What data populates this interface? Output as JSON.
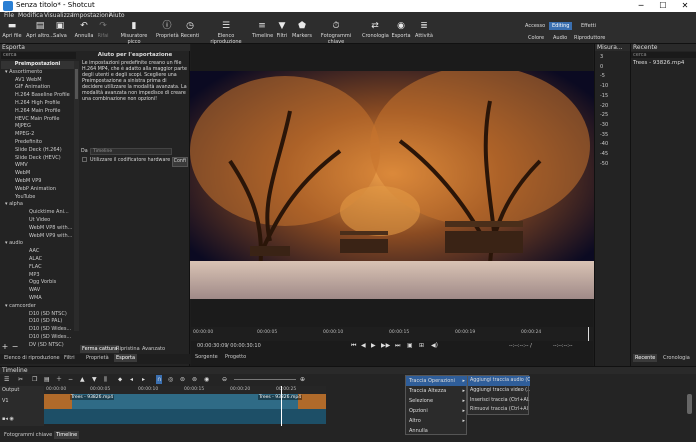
{
  "window": {
    "title": "Senza titolo* - Shotcut",
    "minimize": "─",
    "maximize": "☐",
    "close": "✕"
  },
  "menu": [
    "File",
    "Modifica",
    "Visualizza",
    "Impostazioni",
    "Aiuto"
  ],
  "toolbar": {
    "items": [
      "Apri file",
      "Apri altro...",
      "Salva",
      "Annulla",
      "Rifai",
      "Misuratore picco",
      "Proprietà",
      "Recenti",
      "Elenco riproduzione",
      "Timeline",
      "Filtri",
      "Markers",
      "Fotogrammi chiave",
      "Cronologia",
      "Esporta",
      "Attività"
    ]
  },
  "layouts": {
    "access": "Accesso",
    "editing": "Editing",
    "effects": "Effetti",
    "color": "Colore",
    "audio": "Audio",
    "player": "Riproduttore"
  },
  "export": {
    "header": "Esporta",
    "filter_placeholder": "cerca",
    "presets": [
      {
        "label": "Preimpostazioni",
        "level": "sel"
      },
      {
        "label": "▾ Assortimento",
        "level": "g"
      },
      {
        "label": "AV1 WebM",
        "level": "c1"
      },
      {
        "label": "GIF Animation",
        "level": "c1"
      },
      {
        "label": "H.264 Baseline Profile",
        "level": "c1"
      },
      {
        "label": "H.264 High Profile",
        "level": "c1"
      },
      {
        "label": "H.264 Main Profile",
        "level": "c1"
      },
      {
        "label": "HEVC Main Profile",
        "level": "c1"
      },
      {
        "label": "MJPEG",
        "level": "c1"
      },
      {
        "label": "MPEG-2",
        "level": "c1"
      },
      {
        "label": "Predefinito",
        "level": "c1"
      },
      {
        "label": "Slide Deck (H.264)",
        "level": "c1"
      },
      {
        "label": "Slide Deck (HEVC)",
        "level": "c1"
      },
      {
        "label": "WMV",
        "level": "c1"
      },
      {
        "label": "WebM",
        "level": "c1"
      },
      {
        "label": "WebM VP9",
        "level": "c1"
      },
      {
        "label": "WebP Animation",
        "level": "c1"
      },
      {
        "label": "YouTube",
        "level": "c1"
      },
      {
        "label": "▾ alpha",
        "level": "g"
      },
      {
        "label": "Quicktime Ani...",
        "level": "c2"
      },
      {
        "label": "Ut Video",
        "level": "c2"
      },
      {
        "label": "WebM VP8 with...",
        "level": "c2"
      },
      {
        "label": "WebM VP9 with...",
        "level": "c2"
      },
      {
        "label": "▾ audio",
        "level": "g"
      },
      {
        "label": "AAC",
        "level": "c2"
      },
      {
        "label": "ALAC",
        "level": "c2"
      },
      {
        "label": "FLAC",
        "level": "c2"
      },
      {
        "label": "MP3",
        "level": "c2"
      },
      {
        "label": "Ogg Vorbis",
        "level": "c2"
      },
      {
        "label": "WAV",
        "level": "c2"
      },
      {
        "label": "WMA",
        "level": "c2"
      },
      {
        "label": "▾ camcorder",
        "level": "g"
      },
      {
        "label": "D10 (SD NTSC)",
        "level": "c2"
      },
      {
        "label": "D10 (SD PAL)",
        "level": "c2"
      },
      {
        "label": "D10 (SD Wides...",
        "level": "c2"
      },
      {
        "label": "D10 (SD Wides...",
        "level": "c2"
      },
      {
        "label": "DV (SD NTSC)",
        "level": "c2"
      }
    ],
    "help_title": "Aiuto per l'esportazione",
    "help_text": "Le impostazioni predefinite creano un file H.264 MP4, che è adatto alla maggior parte degli utenti e degli scopi. Scegliere una Preimpostazione a sinistra prima di decidere utilizzare la modalità avanzata. La modalità avanzata non impedisce di creare una combinazione non opzioni!",
    "codec_label": "Da",
    "codec_value": "Timeline",
    "hw_label": "Utilizzare il codificatore hardware",
    "config_button": "Confi",
    "add": "+",
    "remove": "−",
    "tabs": {
      "stop": "Ferma cattura",
      "reset": "Ripristina",
      "advanced": "Avanzato"
    }
  },
  "left_tabs": [
    "Elenco di riproduzione",
    "Filtri",
    "Proprietà",
    "Esporta"
  ],
  "viewer": {
    "ruler": [
      "00:00:00",
      "00:00:05",
      "00:00:10",
      "00:00:15",
      "00:00:19",
      "00:00:24"
    ],
    "timecode": "00:00:30:09",
    "duration": "/ 00:00:30:10",
    "in_out": "--:--:--:-- /",
    "in_out2": "--:--:--:--",
    "tabs": [
      "Sorgente",
      "Progetto"
    ],
    "video_alt": "Snowy night trees"
  },
  "audiometer": {
    "header": "Misura...",
    "labels": [
      "3",
      "0",
      "-5",
      "-10",
      "-15",
      "-20",
      "-25",
      "-30",
      "-35",
      "-40",
      "-45",
      "-50"
    ]
  },
  "recent": {
    "header": "Recente",
    "search_placeholder": "cerca",
    "item": "Trees - 93826.mp4",
    "tabs": [
      "Recente",
      "Cronologia"
    ]
  },
  "timeline": {
    "header": "Timeline",
    "output_label": "Output",
    "track_label": "V1",
    "ruler": [
      "00:00:00",
      "00:00:05",
      "00:00:10",
      "00:00:15",
      "00:00:20",
      "00:00:25"
    ],
    "clip1": "Trees - 93826.mp4",
    "clip2": "Trees - 93826.mp4",
    "menu": [
      "Traccia Operazioni",
      "Traccia Altezza",
      "Selezione",
      "Opzioni",
      "Altro",
      "Annulla"
    ],
    "submenu": [
      "Aggiungi traccia audio (C...",
      "Aggiungi traccia video (...",
      "Inserisci traccia (Ctrl+Al...",
      "Rimuovi traccia (Ctrl+Al..."
    ],
    "bottom_tabs": [
      "Fotogrammi chiave",
      "Timeline"
    ]
  }
}
